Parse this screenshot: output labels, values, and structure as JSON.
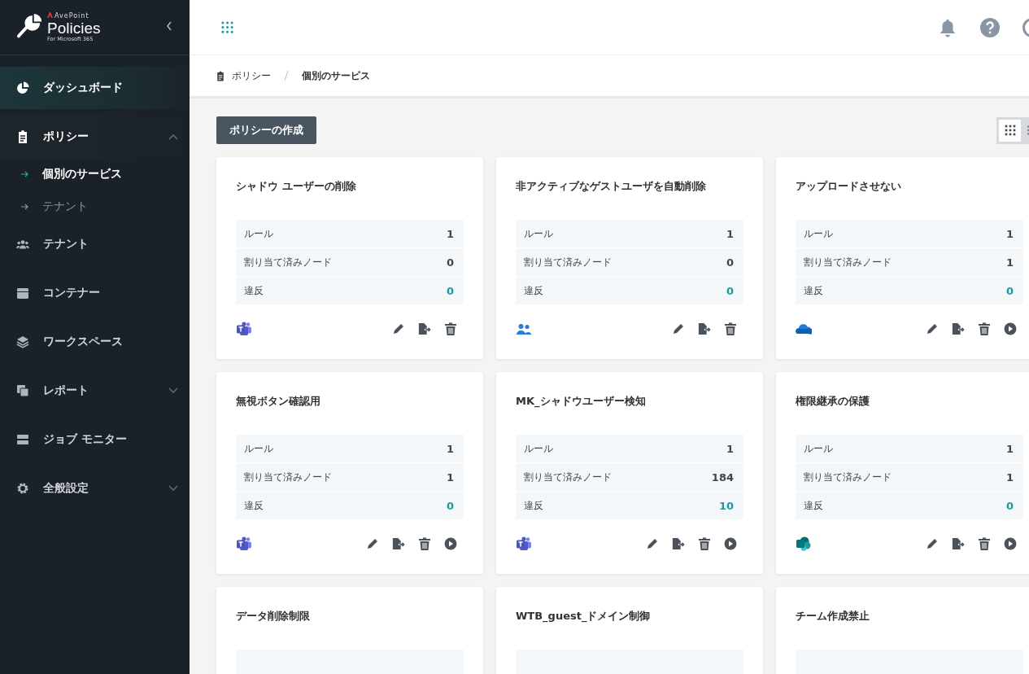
{
  "brand": {
    "company": "AvePoint",
    "product": "Policies",
    "subtitle": "For Microsoft 365"
  },
  "sidebar": {
    "items": [
      {
        "label": "ダッシュボード",
        "kind": "dashboard",
        "selected": true
      },
      {
        "label": "ポリシー",
        "kind": "policy",
        "selected": false,
        "expanded": true,
        "children": [
          {
            "label": "個別のサービス",
            "selected": true
          },
          {
            "label": "テナント",
            "selected": false
          }
        ]
      },
      {
        "label": "テナント",
        "kind": "tenant",
        "selected": false
      },
      {
        "label": "コンテナー",
        "kind": "container",
        "selected": false
      },
      {
        "label": "ワークスペース",
        "kind": "workspace",
        "selected": false
      },
      {
        "label": "レポート",
        "kind": "report",
        "selected": false,
        "expanded": false
      },
      {
        "label": "ジョブ モニター",
        "kind": "job",
        "selected": false
      },
      {
        "label": "全般設定",
        "kind": "settings",
        "selected": false,
        "expanded": false
      }
    ]
  },
  "breadcrumb": [
    "ポリシー",
    "個別のサービス"
  ],
  "create_button": "ポリシーの作成",
  "view_toggle": [
    {
      "kind": "grid",
      "selected": true
    },
    {
      "kind": "list",
      "selected": false
    }
  ],
  "cards": [
    {
      "title": "シャドウ ユーザーの削除",
      "kind": "teams",
      "runnable": false,
      "rows": [
        {
          "label": "ルール",
          "value": "1",
          "kind": "count"
        },
        {
          "label": "割り当て済みノード",
          "value": "0",
          "kind": "count"
        },
        {
          "label": "違反",
          "value": "0",
          "kind": "violation"
        }
      ]
    },
    {
      "title": "非アクティブなゲストユーザを自動削除",
      "kind": "groups",
      "runnable": false,
      "rows": [
        {
          "label": "ルール",
          "value": "1",
          "kind": "count"
        },
        {
          "label": "割り当て済みノード",
          "value": "0",
          "kind": "count"
        },
        {
          "label": "違反",
          "value": "0",
          "kind": "violation"
        }
      ]
    },
    {
      "title": "アップロードさせない",
      "kind": "onedrive",
      "runnable": true,
      "rows": [
        {
          "label": "ルール",
          "value": "1",
          "kind": "count"
        },
        {
          "label": "割り当て済みノード",
          "value": "1",
          "kind": "count"
        },
        {
          "label": "違反",
          "value": "0",
          "kind": "violation"
        }
      ]
    },
    {
      "title": "無視ボタン確認用",
      "kind": "teams",
      "runnable": true,
      "rows": [
        {
          "label": "ルール",
          "value": "1",
          "kind": "count"
        },
        {
          "label": "割り当て済みノード",
          "value": "1",
          "kind": "count"
        },
        {
          "label": "違反",
          "value": "0",
          "kind": "violation"
        }
      ]
    },
    {
      "title": "MK_シャドウユーザー検知",
      "kind": "teams",
      "runnable": true,
      "rows": [
        {
          "label": "ルール",
          "value": "1",
          "kind": "count"
        },
        {
          "label": "割り当て済みノード",
          "value": "184",
          "kind": "count"
        },
        {
          "label": "違反",
          "value": "10",
          "kind": "violation"
        }
      ]
    },
    {
      "title": "権限継承の保護",
      "kind": "sharepoint",
      "runnable": true,
      "rows": [
        {
          "label": "ルール",
          "value": "1",
          "kind": "count"
        },
        {
          "label": "割り当て済みノード",
          "value": "1",
          "kind": "count"
        },
        {
          "label": "違反",
          "value": "0",
          "kind": "violation"
        }
      ]
    },
    {
      "title": "データ削除制限"
    },
    {
      "title": "WTB_guest_ドメイン制御"
    },
    {
      "title": "チーム作成禁止"
    }
  ]
}
